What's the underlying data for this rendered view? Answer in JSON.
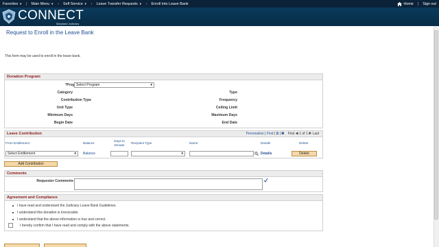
{
  "topnav": {
    "items": [
      "Favorites",
      "Main Menu",
      "Self Service",
      "Leave Transfer Requests",
      "Enroll into Leave Bank"
    ],
    "home": "Home",
    "signout": "Sign out"
  },
  "logo": {
    "text": "CONNECT",
    "sub": "Maryland Judiciary"
  },
  "page": {
    "title": "Request to Enroll in the Leave Bank",
    "intro": "This form may be used to enroll in the leave bank."
  },
  "donation": {
    "header": "Donation Program",
    "program_label": "*Program Name",
    "program_value": "Select Program",
    "left_labels": [
      "Category",
      "Contribution Type",
      "Unit Type",
      "Minimum Days",
      "Begin Date"
    ],
    "right_labels": [
      "Type",
      "Frequency",
      "Ceiling Limit",
      "Maximum Days",
      "End Date"
    ]
  },
  "leave": {
    "header": "Leave Contribution",
    "tools": {
      "personalize": "Personalize",
      "find": "Find",
      "first": "First",
      "range": "1 of 1",
      "last": "Last"
    },
    "columns": [
      "From Entitlement",
      "Balance",
      "Days to Donate",
      "Recipient Type",
      "Name",
      "Details",
      "Delete"
    ],
    "row": {
      "entitlement": "Select Entitlement",
      "balance": "Balance",
      "details": "Details",
      "delete": "Delete"
    },
    "add_button": "Add Contribution"
  },
  "comments": {
    "header": "Comments",
    "label": "Requester Comments"
  },
  "agreement": {
    "header": "Agreement and Compliance",
    "statements": [
      "I have read and understand the Judiciary Leave Bank Guidelines.",
      "I understand this donation is irrevocable.",
      "I understand that the above information is true and correct."
    ],
    "confirm": "I hereby confirm that I have read and comply with the above statements."
  },
  "colors": {
    "nav": "#0b2239",
    "banner": "#0a3a5c",
    "title": "#1f4e90",
    "section": "#8b1a1a",
    "button": "#f6d9a8"
  },
  "icons": [
    "home-icon",
    "seal-logo",
    "lookup-icon",
    "spellcheck-icon",
    "first-arrow-icon",
    "last-arrow-icon",
    "view-all-icon"
  ]
}
